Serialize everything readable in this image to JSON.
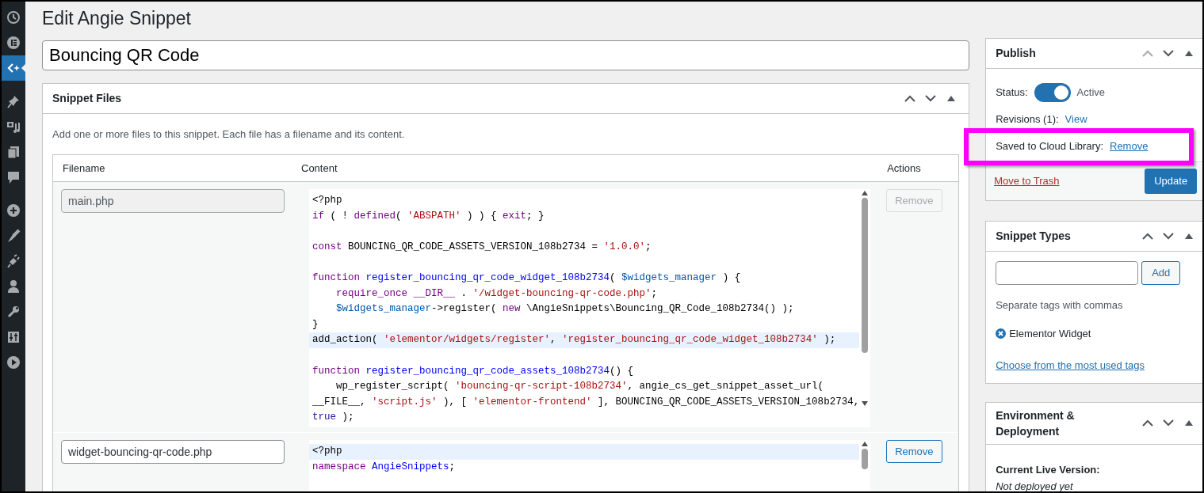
{
  "sidebar_items": [
    {
      "selected": false
    },
    {
      "selected": false
    },
    {
      "selected": true
    },
    {
      "selected": false
    },
    {
      "selected": false
    },
    {
      "selected": false
    },
    {
      "selected": false
    },
    {
      "selected": false
    },
    {
      "selected": false
    },
    {
      "selected": false
    },
    {
      "selected": false
    },
    {
      "selected": false
    },
    {
      "selected": false
    },
    {
      "selected": false
    }
  ],
  "page_title": "Edit Angie Snippet",
  "snippet_title": "Bouncing QR Code",
  "snippet_files": {
    "title": "Snippet Files",
    "description": "Add one or more files to this snippet. Each file has a filename and its content.",
    "columns": [
      "Filename",
      "Content",
      "Actions"
    ],
    "rows": [
      {
        "filename": "main.php",
        "disabled": true,
        "remove": "Remove",
        "lines": [
          {
            "kind": "code",
            "active": false,
            "indented": false,
            "tokens": [
              {
                "t": "<?php"
              }
            ]
          },
          {
            "kind": "code",
            "active": false,
            "indented": false,
            "tokens": [
              {
                "t": "if",
                "color": "#770088"
              },
              {
                "t": " ( ! "
              },
              {
                "t": "defined",
                "color": "#770088"
              },
              {
                "t": "( "
              },
              {
                "t": "'ABSPATH'",
                "color": "#aa1111"
              },
              {
                "t": " ) ) { "
              },
              {
                "t": "exit",
                "color": "#770088"
              },
              {
                "t": "; }"
              }
            ]
          },
          {
            "kind": "blank"
          },
          {
            "kind": "code",
            "active": false,
            "indented": false,
            "tokens": [
              {
                "t": "const",
                "color": "#770088"
              },
              {
                "t": " BOUNCING_QR_CODE_ASSETS_VERSION_108b2734 = "
              },
              {
                "t": "'1.0.0'",
                "color": "#aa1111"
              },
              {
                "t": ";"
              }
            ]
          },
          {
            "kind": "blank"
          },
          {
            "kind": "code",
            "active": false,
            "indented": false,
            "tokens": [
              {
                "t": "function ",
                "color": "#770088"
              },
              {
                "t": "register_bouncing_qr_code_widget_108b2734",
                "color": "#0000ff"
              },
              {
                "t": "( "
              },
              {
                "t": "$widgets_manager",
                "color": "#0055aa"
              },
              {
                "t": " ) {"
              }
            ]
          },
          {
            "kind": "code",
            "active": false,
            "indented": true,
            "tokens": [
              {
                "t": "require_once __DIR__",
                "color": "#770088"
              },
              {
                "t": " . "
              },
              {
                "t": "'/widget-bouncing-qr-code.php'",
                "color": "#aa1111"
              },
              {
                "t": ";"
              }
            ]
          },
          {
            "kind": "code",
            "active": false,
            "indented": true,
            "tokens": [
              {
                "t": "$widgets_manager",
                "color": "#0055aa"
              },
              {
                "t": "->register( "
              },
              {
                "t": "new",
                "color": "#770088"
              },
              {
                "t": " \\AngieSnippets\\Bouncing_QR_Code_108b2734() );"
              }
            ]
          },
          {
            "kind": "code",
            "active": false,
            "indented": false,
            "tokens": [
              {
                "t": "}"
              }
            ]
          },
          {
            "kind": "code",
            "active": true,
            "indented": false,
            "tokens": [
              {
                "t": "add_action( "
              },
              {
                "t": "'elementor/widgets/register'",
                "color": "#aa1111"
              },
              {
                "t": ", "
              },
              {
                "t": "'register_bouncing_qr_code_widget_108b2734'",
                "color": "#aa1111"
              },
              {
                "t": " );"
              }
            ]
          },
          {
            "kind": "blank"
          },
          {
            "kind": "code",
            "active": false,
            "indented": false,
            "tokens": [
              {
                "t": "function ",
                "color": "#770088"
              },
              {
                "t": "register_bouncing_qr_code_assets_108b2734",
                "color": "#0000ff"
              },
              {
                "t": "() {"
              }
            ]
          },
          {
            "kind": "code",
            "active": false,
            "indented": true,
            "tokens": [
              {
                "t": "wp_register_script( "
              },
              {
                "t": "'bouncing-qr-script-108b2734'",
                "color": "#aa1111"
              },
              {
                "t": ", angie_cs_get_snippet_asset_url("
              }
            ]
          },
          {
            "kind": "code",
            "active": false,
            "indented": false,
            "tokens": [
              {
                "t": "__FILE__, "
              },
              {
                "t": "'script.js'",
                "color": "#aa1111"
              },
              {
                "t": " ), [ "
              },
              {
                "t": "'elementor-frontend'",
                "color": "#aa1111"
              },
              {
                "t": " ], BOUNCING_QR_CODE_ASSETS_VERSION_108b2734,"
              }
            ]
          },
          {
            "kind": "code",
            "active": false,
            "indented": false,
            "tokens": [
              {
                "t": "true",
                "color": "#221199"
              },
              {
                "t": " );"
              }
            ]
          }
        ]
      },
      {
        "filename": "widget-bouncing-qr-code.php",
        "disabled": false,
        "remove": "Remove",
        "lines": [
          {
            "kind": "code",
            "active": true,
            "indented": false,
            "tokens": [
              {
                "t": "<?php"
              }
            ]
          },
          {
            "kind": "code",
            "active": false,
            "indented": false,
            "tokens": [
              {
                "t": "namespace ",
                "color": "#770088"
              },
              {
                "t": "AngieSnippets",
                "color": "#0000ff"
              },
              {
                "t": ";"
              }
            ]
          }
        ]
      }
    ]
  },
  "publish": {
    "title": "Publish",
    "status_label": "Status:",
    "status_on": true,
    "status_text": "Active",
    "revisions_label": "Revisions (1):",
    "revisions_link": "View",
    "cloud_label": "Saved to Cloud Library:",
    "cloud_link": "Remove",
    "cloud_highlighted": true,
    "trash": "Move to Trash",
    "update": "Update"
  },
  "snippet_types": {
    "title": "Snippet Types",
    "add": "Add",
    "hint": "Separate tags with commas",
    "tags": [
      "Elementor Widget"
    ],
    "choose_link": "Choose from the most used tags"
  },
  "environment": {
    "title": "Environment & Deployment",
    "live_label": "Current Live Version:",
    "live_value": "Not deployed yet"
  }
}
